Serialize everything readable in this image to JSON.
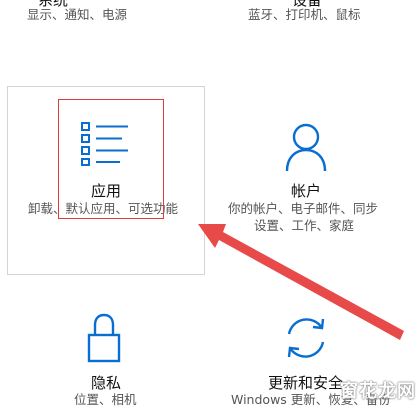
{
  "top_partial": {
    "system_title": "系统",
    "system_desc": "显示、通知、电源",
    "devices_title": "设备",
    "devices_desc": "蓝牙、打印机、鼠标"
  },
  "categories": {
    "apps": {
      "title": "应用",
      "desc_line1": "卸载、默认应用、可选功能",
      "icon": "app-list-icon"
    },
    "accounts": {
      "title": "帐户",
      "desc_line1": "你的帐户、电子邮件、同步",
      "desc_line2": "设置、工作、家庭",
      "icon": "person-icon"
    },
    "privacy": {
      "title": "隐私",
      "desc_line1": "位置、相机",
      "icon": "lock-icon"
    },
    "update": {
      "title": "更新和安全",
      "desc_line1": "Windows 更新、恢复、备份",
      "icon": "sync-icon"
    }
  },
  "annotation": {
    "color": "#e84a4a"
  },
  "watermark": {
    "text_main": "窗花龙网",
    "text_sub": ""
  },
  "colors": {
    "accent": "#0a6ed1",
    "text": "#111111",
    "subtext": "#555555",
    "border": "#d4d4d4"
  }
}
